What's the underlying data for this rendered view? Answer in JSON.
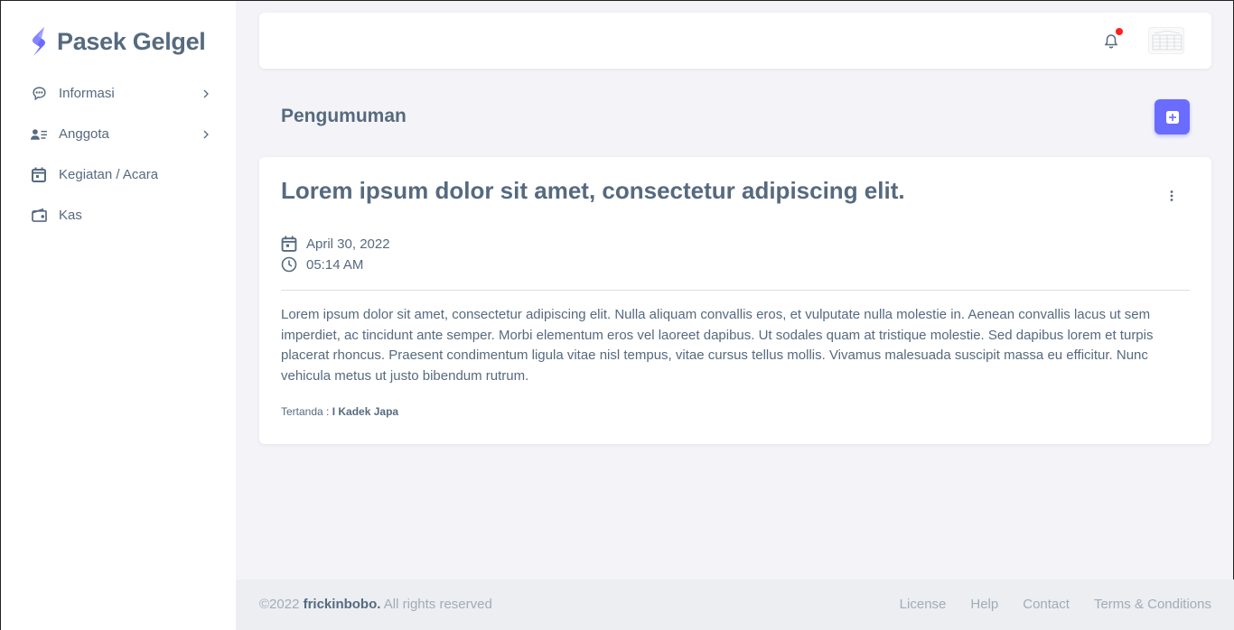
{
  "brand": {
    "name": "Pasek Gelgel",
    "logo_icon": "brand-s-logo",
    "accent": "#696cff"
  },
  "sidebar": {
    "items": [
      {
        "label": "Informasi",
        "icon": "chat-bubble-icon",
        "has_submenu": true
      },
      {
        "label": "Anggota",
        "icon": "user-list-icon",
        "has_submenu": true
      },
      {
        "label": "Kegiatan / Acara",
        "icon": "calendar-icon",
        "has_submenu": false
      },
      {
        "label": "Kas",
        "icon": "wallet-icon",
        "has_submenu": false
      }
    ]
  },
  "navbar": {
    "notification_icon": "bell-icon",
    "has_unread": true,
    "unread_color": "#ff1f1f"
  },
  "page": {
    "title": "Pengumuman",
    "add_icon": "plus-square-icon"
  },
  "announcement": {
    "title": "Lorem ipsum dolor sit amet, consectetur adipiscing elit.",
    "date": "April 30, 2022",
    "time": "05:14 AM",
    "body": "Lorem ipsum dolor sit amet, consectetur adipiscing elit. Nulla aliquam convallis eros, et vulputate nulla molestie in. Aenean convallis lacus ut sem imperdiet, ac tincidunt ante semper. Morbi elementum eros vel laoreet dapibus. Ut sodales quam at tristique molestie. Sed dapibus lorem et turpis placerat rhoncus. Praesent condimentum ligula vitae nisl tempus, vitae cursus tellus mollis. Vivamus malesuada suscipit massa eu efficitur. Nunc vehicula metus ut justo bibendum rutrum.",
    "signed_label": "Tertanda :",
    "signed_name": "I Kadek Japa"
  },
  "footer": {
    "copyright_prefix": "©2022",
    "company": "frickinbobo.",
    "rights": "All rights reserved",
    "links": [
      "License",
      "Help",
      "Contact",
      "Terms & Conditions"
    ]
  }
}
